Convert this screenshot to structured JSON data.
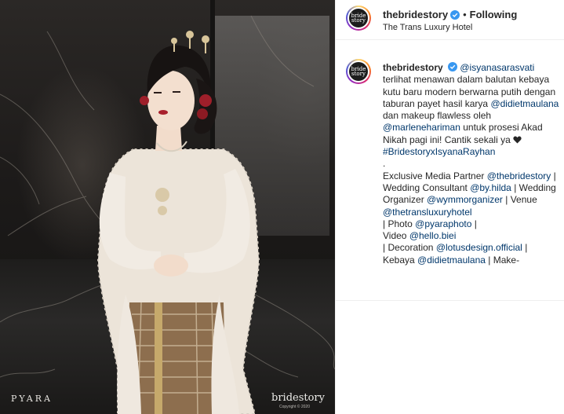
{
  "photo": {
    "credit": "PYARA",
    "brand": "bridestory",
    "brand_copyright": "Copyright © 2020"
  },
  "post": {
    "username": "thebridestory",
    "follow_separator": "•",
    "follow_label": "Following",
    "location": "The Trans Luxury Hotel",
    "avatar_text_top": "bride",
    "avatar_text_bottom": "story"
  },
  "caption": {
    "author": "thebridestory",
    "mention_1": "@isyanasarasvati",
    "text_1": "terlihat menawan dalam balutan kebaya kutu baru modern berwarna putih dengan taburan payet hasil karya",
    "mention_2": "@didietmaulana",
    "text_2": "dan makeup flawless oleh",
    "mention_3": "@marlenehariman",
    "text_3": "untuk prosesi Akad Nikah pagi ini! Cantik sekali ya",
    "hashtag": "#BridestoryxIsyanaRayhan",
    "period": ".",
    "text_4": "Exclusive Media Partner",
    "mention_4": "@thebridestory",
    "text_5": "| Wedding Consultant",
    "mention_5": "@by.hilda",
    "text_6": "| Wedding Organizer",
    "mention_6": "@wymmorganizer",
    "text_7": "| Venue",
    "mention_7": "@thetransluxuryhotel",
    "text_8": "| Photo",
    "mention_8": "@pyaraphoto",
    "text_9": "|",
    "text_10": "Video",
    "mention_9": "@hello.biei",
    "text_11": "| Decoration",
    "mention_10": "@lotusdesign.official",
    "text_12": "|",
    "text_13": "Kebaya",
    "mention_11": "@didietmaulana",
    "text_14": "| Make-"
  },
  "colors": {
    "link": "#00376b",
    "verified": "#3897f0",
    "text": "#262626"
  },
  "icons": {
    "verified": "verified-badge-icon",
    "heart": "black-heart-icon"
  }
}
